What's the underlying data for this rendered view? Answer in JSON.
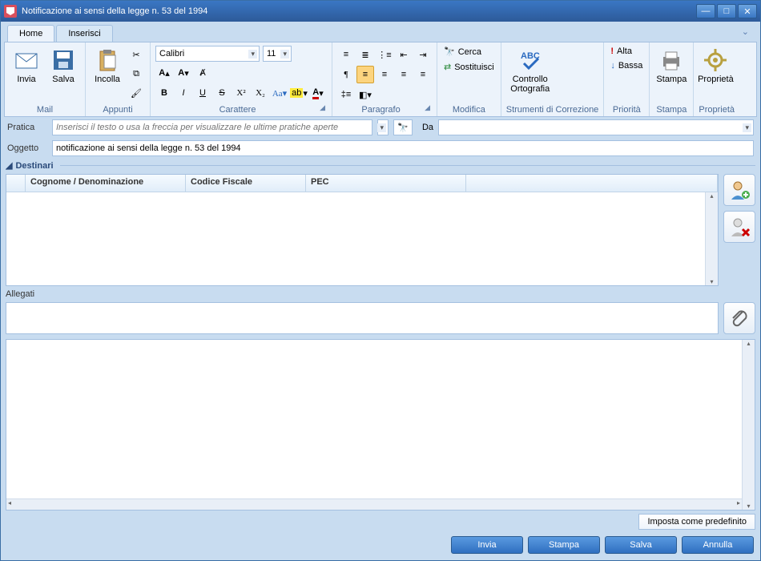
{
  "window": {
    "title": "Notificazione ai sensi della legge n. 53 del 1994"
  },
  "tabs": {
    "home": "Home",
    "inserisci": "Inserisci"
  },
  "ribbon": {
    "mail": {
      "invia": "Invia",
      "salva": "Salva",
      "label": "Mail"
    },
    "appunti": {
      "incolla": "Incolla",
      "label": "Appunti"
    },
    "carattere": {
      "font": "Calibri",
      "size": "11",
      "label": "Carattere"
    },
    "paragrafo": {
      "label": "Paragrafo"
    },
    "modifica": {
      "cerca": "Cerca",
      "sostituisci": "Sostituisci",
      "label": "Modifica"
    },
    "correzione": {
      "controllo": "Controllo",
      "ortografia": "Ortografia",
      "label": "Strumenti di Correzione"
    },
    "priorita": {
      "alta": "Alta",
      "bassa": "Bassa",
      "label": "Priorità"
    },
    "stampa": {
      "btn": "Stampa",
      "label": "Stampa"
    },
    "proprieta": {
      "btn": "Proprietà",
      "label": "Proprietà"
    }
  },
  "fields": {
    "pratica_label": "Pratica",
    "pratica_placeholder": "Inserisci il testo o usa la freccia per visualizzare le ultime pratiche aperte",
    "da_label": "Da",
    "oggetto_label": "Oggetto",
    "oggetto_value": "notificazione ai sensi della legge n. 53 del 1994"
  },
  "destinari": {
    "title": "Destinari",
    "cols": {
      "cognome": "Cognome / Denominazione",
      "codice": "Codice Fiscale",
      "pec": "PEC"
    }
  },
  "allegati": {
    "title": "Allegati"
  },
  "footer": {
    "imposta": "Imposta come predefinito"
  },
  "buttons": {
    "invia": "Invia",
    "stampa": "Stampa",
    "salva": "Salva",
    "annulla": "Annulla"
  }
}
